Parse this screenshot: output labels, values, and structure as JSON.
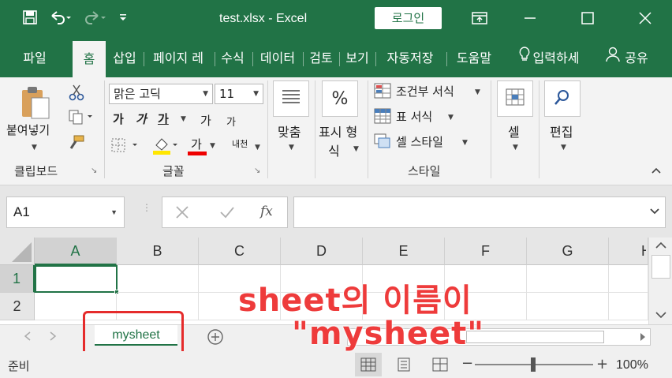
{
  "title_bar": {
    "title": "test.xlsx  -  Excel",
    "login_label": "로그인"
  },
  "ribbon_tabs": [
    "파일",
    "홈",
    "삽입",
    "페이지 레",
    "수식",
    "데이터",
    "검토",
    "보기",
    "자동저장",
    "도움말",
    "입력하세",
    "공유"
  ],
  "ribbon": {
    "clipboard": {
      "paste_label": "붙여넣기",
      "group_label": "클립보드"
    },
    "font": {
      "font_name": "맑은 고딕",
      "font_size": "11",
      "bold": "가",
      "italic": "가",
      "underline": "가",
      "grow": "가",
      "shrink": "가",
      "font_color_glyph": "가",
      "phonetic": "내천",
      "group_label": "글꼴"
    },
    "alignment": {
      "label": "맞춤"
    },
    "number": {
      "label_line1": "표시 형",
      "label_line2": "식",
      "percent": "%"
    },
    "styles": {
      "conditional": "조건부 서식",
      "table_format": "표 서식",
      "cell_style": "셀 스타일",
      "group_label": "스타일"
    },
    "cells": {
      "label": "셀"
    },
    "editing": {
      "label": "편집"
    }
  },
  "formula_bar": {
    "name_box": "A1",
    "fx": "fx",
    "formula": ""
  },
  "grid": {
    "columns": [
      "A",
      "B",
      "C",
      "D",
      "E",
      "F",
      "G",
      "H"
    ],
    "rows": [
      "1",
      "2"
    ],
    "selected_cell": "A1"
  },
  "sheets": {
    "tabs": [
      "mysheet"
    ],
    "active": "mysheet"
  },
  "status_bar": {
    "status": "준비",
    "zoom": "100%"
  },
  "annotation": {
    "line1": "sheet의 이름이",
    "line2": "\"mysheet\""
  },
  "colors": {
    "excel_green": "#217346",
    "annotation_red": "#ee3b3b",
    "highlight_red": "#e52b2b"
  }
}
